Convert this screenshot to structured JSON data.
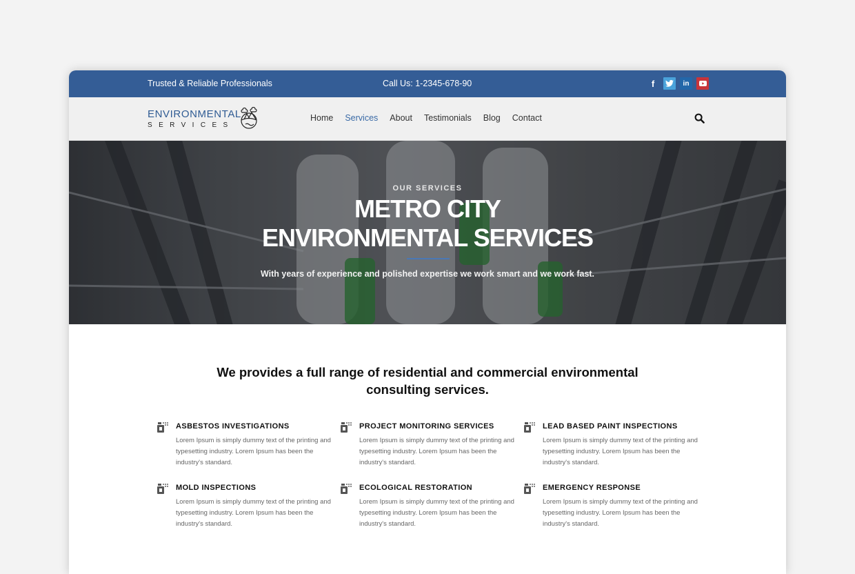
{
  "topbar": {
    "tagline": "Trusted & Reliable Professionals",
    "phone": "Call Us: 1-2345-678-90",
    "social": [
      {
        "name": "facebook",
        "glyph": "f"
      },
      {
        "name": "twitter",
        "glyph": "t"
      },
      {
        "name": "linkedin",
        "glyph": "in"
      },
      {
        "name": "youtube",
        "glyph": "▶"
      }
    ],
    "color": "#345d96"
  },
  "logo": {
    "line1": "ENVIRONMENTAL",
    "line2": "SERVICES"
  },
  "nav": {
    "items": [
      {
        "label": "Home",
        "active": false
      },
      {
        "label": "Services",
        "active": true
      },
      {
        "label": "About",
        "active": false
      },
      {
        "label": "Testimonials",
        "active": false
      },
      {
        "label": "Blog",
        "active": false
      },
      {
        "label": "Contact",
        "active": false
      }
    ],
    "search_icon": "search-icon"
  },
  "hero": {
    "eyebrow": "OUR SERVICES",
    "title_line1": "METRO CITY",
    "title_line2": "ENVIRONMENTAL SERVICES",
    "subtitle": "With years of experience and polished expertise we work smart and we work fast."
  },
  "intro": {
    "line1": "We provides a full range of residential and commercial environmental",
    "line2": "consulting services."
  },
  "services": [
    {
      "title": "ASBESTOS INVESTIGATIONS",
      "text": "Lorem Ipsum is simply dummy text of the printing and typesetting industry. Lorem Ipsum has been the industry's standard.",
      "icon": "spray-bottle-icon"
    },
    {
      "title": "PROJECT MONITORING SERVICES",
      "text": "Lorem Ipsum is simply dummy text of the printing and typesetting industry. Lorem Ipsum has been the industry's standard.",
      "icon": "spray-bottle-icon"
    },
    {
      "title": "LEAD BASED PAINT INSPECTIONS",
      "text": "Lorem Ipsum is simply dummy text of the printing and typesetting industry. Lorem Ipsum has been the industry's standard.",
      "icon": "spray-bottle-icon"
    },
    {
      "title": "MOLD INSPECTIONS",
      "text": "Lorem Ipsum is simply dummy text of the printing and typesetting industry. Lorem Ipsum has been the industry's standard.",
      "icon": "spray-bottle-icon"
    },
    {
      "title": "ECOLOGICAL RESTORATION",
      "text": "Lorem Ipsum is simply dummy text of the printing and typesetting industry. Lorem Ipsum has been the industry's standard.",
      "icon": "spray-bottle-icon"
    },
    {
      "title": "EMERGENCY RESPONSE",
      "text": "Lorem Ipsum is simply dummy text of the printing and typesetting industry. Lorem Ipsum has been the industry's standard.",
      "icon": "spray-bottle-icon"
    }
  ]
}
